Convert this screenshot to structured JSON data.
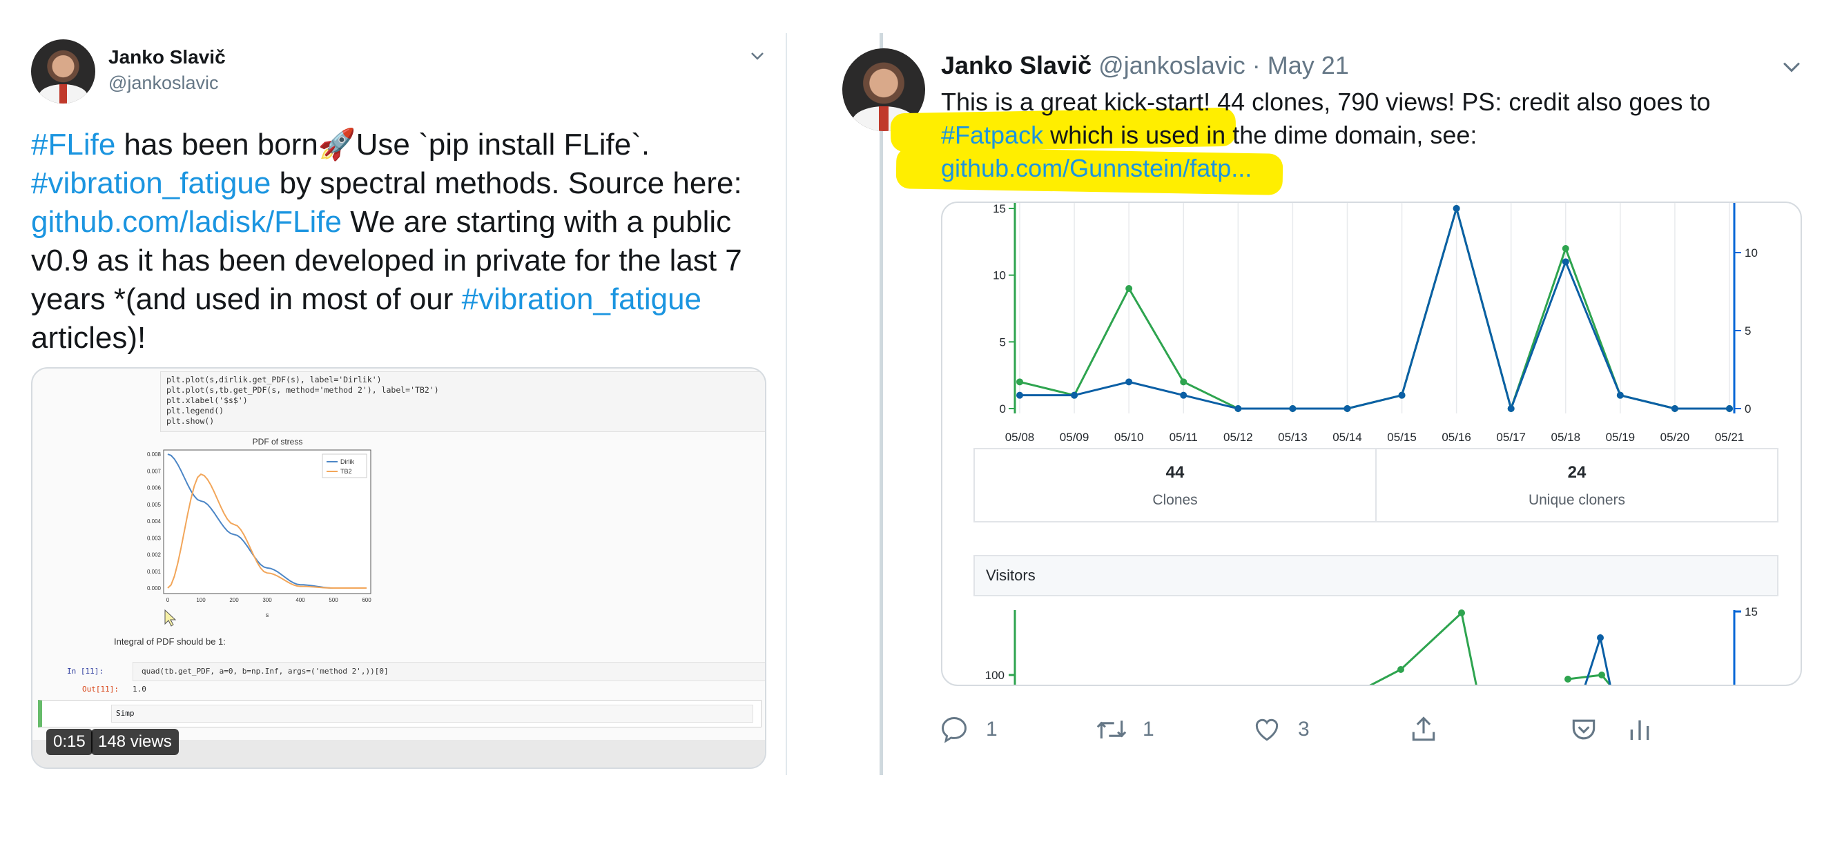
{
  "left_tweet": {
    "name": "Janko Slavič",
    "handle": "@jankoslavic",
    "text_lines": [
      {
        "tag": "#FLife",
        "text": " has been born",
        "emoji": "🚀",
        "after": "Use `pip install FLife`."
      },
      {
        "tag": "#vibration_fatigue",
        "text": " by spectral methods. Source here:"
      },
      {
        "link": "github.com/ladisk/FLife",
        "text": " We are starting with a public"
      },
      {
        "text": "v0.9 as it has been developed in private for the last 7"
      },
      {
        "text": "years *(and used in most of our ",
        "tag": "#vibration_fatigue"
      },
      {
        "text": "articles)!"
      }
    ],
    "video": {
      "code": "plt.plot(s,dirlik.get_PDF(s), label='Dirlik')\nplt.plot(s,tb.get_PDF(s, method='method 2'), label='TB2')\nplt.xlabel('$s$')\nplt.legend()\nplt.show()",
      "plot_title": "PDF of stress",
      "legend": [
        "Dirlik",
        "TB2"
      ],
      "y_ticks": [
        "0.008",
        "0.007",
        "0.006",
        "0.005",
        "0.004",
        "0.003",
        "0.002",
        "0.001",
        "0.000"
      ],
      "x_ticks": [
        "0",
        "100",
        "200",
        "300",
        "400",
        "500",
        "600"
      ],
      "x_label": "s",
      "integral_text": "Integral of PDF should be 1:",
      "in_prompt": "In [11]:",
      "in_code": "quad(tb.get_PDF, a=0, b=np.Inf, args=('method 2',))[0]",
      "out_prompt": "Out[11]:",
      "out_value": "1.0",
      "typing_text": "Simp",
      "duration": "0:15",
      "views": "148 views"
    }
  },
  "right_tweet": {
    "name": "Janko Slavič",
    "handle": "@jankoslavic",
    "date": "· May 21",
    "text_line1": "This is a great kick-start! 44 clones, 790 views! PS: credit also goes to",
    "text_line2_tag": "#Fatpack",
    "text_line2_rest": " which is used in the dime domain, see:",
    "text_line3_link": "github.com/Gunnstein/fatp...",
    "clones_chart": {
      "dates": [
        "05/08",
        "05/09",
        "05/10",
        "05/11",
        "05/12",
        "05/13",
        "05/14",
        "05/15",
        "05/16",
        "05/17",
        "05/18",
        "05/19",
        "05/20",
        "05/21"
      ],
      "left_ticks": [
        "15",
        "10",
        "5",
        "0"
      ],
      "right_ticks": [
        "10",
        "5",
        "0"
      ],
      "clones_total": "44",
      "clones_label": "Clones",
      "unique_total": "24",
      "unique_label": "Unique cloners"
    },
    "visitors_title": "Visitors",
    "visitors_left_tick": "100",
    "visitors_right_tick": "15",
    "actions": {
      "reply_count": "1",
      "retweet_count": "1",
      "like_count": "3"
    },
    "colors": {
      "green": "#2ea44f",
      "blue": "#0366d6",
      "highlight": "#ffee00",
      "link": "#1b95e0"
    }
  },
  "chart_data": [
    {
      "type": "line",
      "x": [
        "05/08",
        "05/09",
        "05/10",
        "05/11",
        "05/12",
        "05/13",
        "05/14",
        "05/15",
        "05/16",
        "05/17",
        "05/18",
        "05/19",
        "05/20",
        "05/21"
      ],
      "series": [
        {
          "values": [
            2,
            1,
            9,
            2,
            0,
            0,
            0,
            1,
            15,
            0,
            12,
            1,
            0,
            0
          ]
        },
        {
          "values": [
            1,
            1,
            2,
            1,
            0,
            0,
            0,
            1,
            15,
            0,
            11,
            1,
            0,
            0
          ]
        }
      ],
      "ylim": [
        0,
        15
      ],
      "y2_ticks": [
        0,
        5,
        10
      ]
    },
    {
      "type": "line",
      "x": [
        "0",
        "100",
        "200",
        "300",
        "400",
        "500",
        "600"
      ],
      "title": "PDF of stress",
      "xlabel": "s",
      "series": [
        {
          "name": "Dirlik",
          "values": [
            0.008,
            0.0052,
            0.0032,
            0.0012,
            0.0002,
            0.0,
            0.0
          ]
        },
        {
          "name": "TB2",
          "values": [
            0.0,
            0.0068,
            0.0038,
            0.0009,
            0.0001,
            0.0,
            0.0
          ]
        }
      ],
      "ylim": [
        0,
        0.008
      ]
    }
  ]
}
